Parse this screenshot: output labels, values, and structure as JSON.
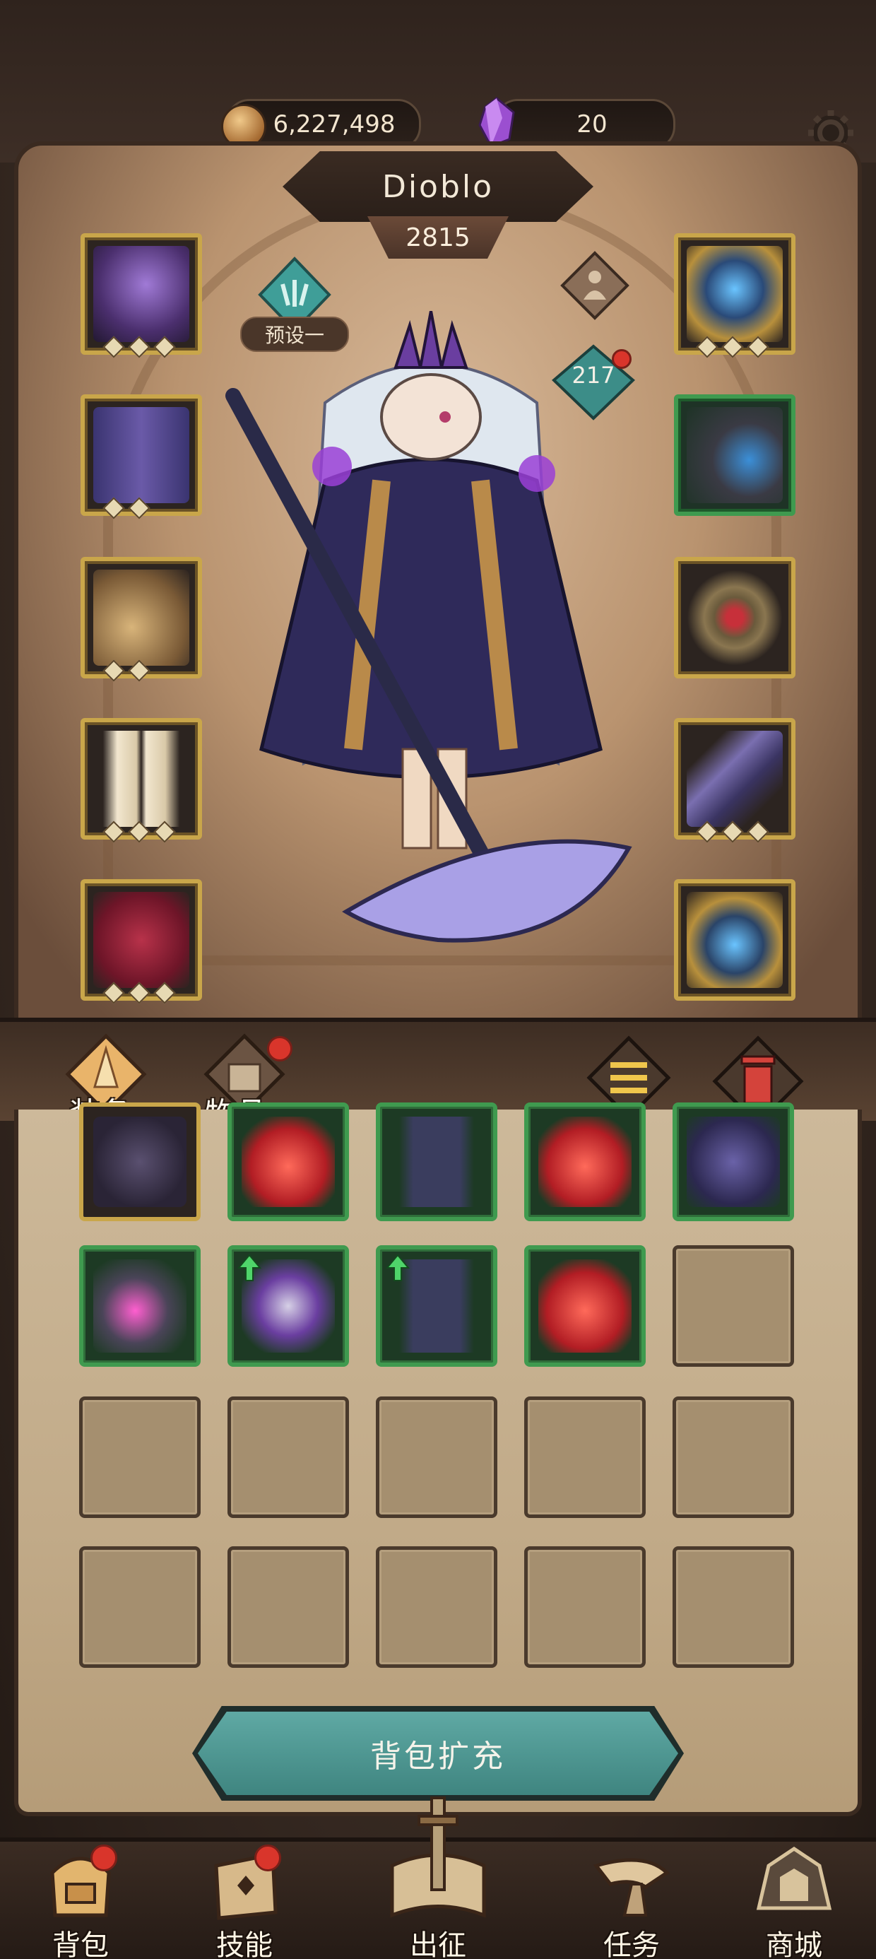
{
  "currency": {
    "coins": "6,227,498",
    "gems": "20"
  },
  "hero": {
    "name": "Dioblo",
    "power": "2815",
    "level": "217",
    "preset_label": "预设一"
  },
  "equipment_slots": {
    "left": [
      "helmet-slot",
      "armor-slot",
      "bracer-slot",
      "leggings-slot",
      "boots-slot"
    ],
    "right": [
      "weapon-slot",
      "amulet-slot",
      "ring-slot",
      "offhand-slot",
      "crest-slot"
    ]
  },
  "inventory": {
    "tabs": [
      {
        "label": "装备",
        "active": true
      },
      {
        "label": "物品",
        "active": false
      }
    ],
    "rows": 4,
    "columns": 5,
    "expand_label": "背包扩充"
  },
  "bottom_nav": [
    {
      "label": "背包"
    },
    {
      "label": "技能"
    },
    {
      "label": "出征"
    },
    {
      "label": "任务"
    },
    {
      "label": "商城"
    }
  ],
  "colors": {
    "gold_frame": "#c9a64a",
    "green_frame": "#3f9a4f",
    "notification": "#d9352b",
    "expand_button": "#4f978f"
  }
}
